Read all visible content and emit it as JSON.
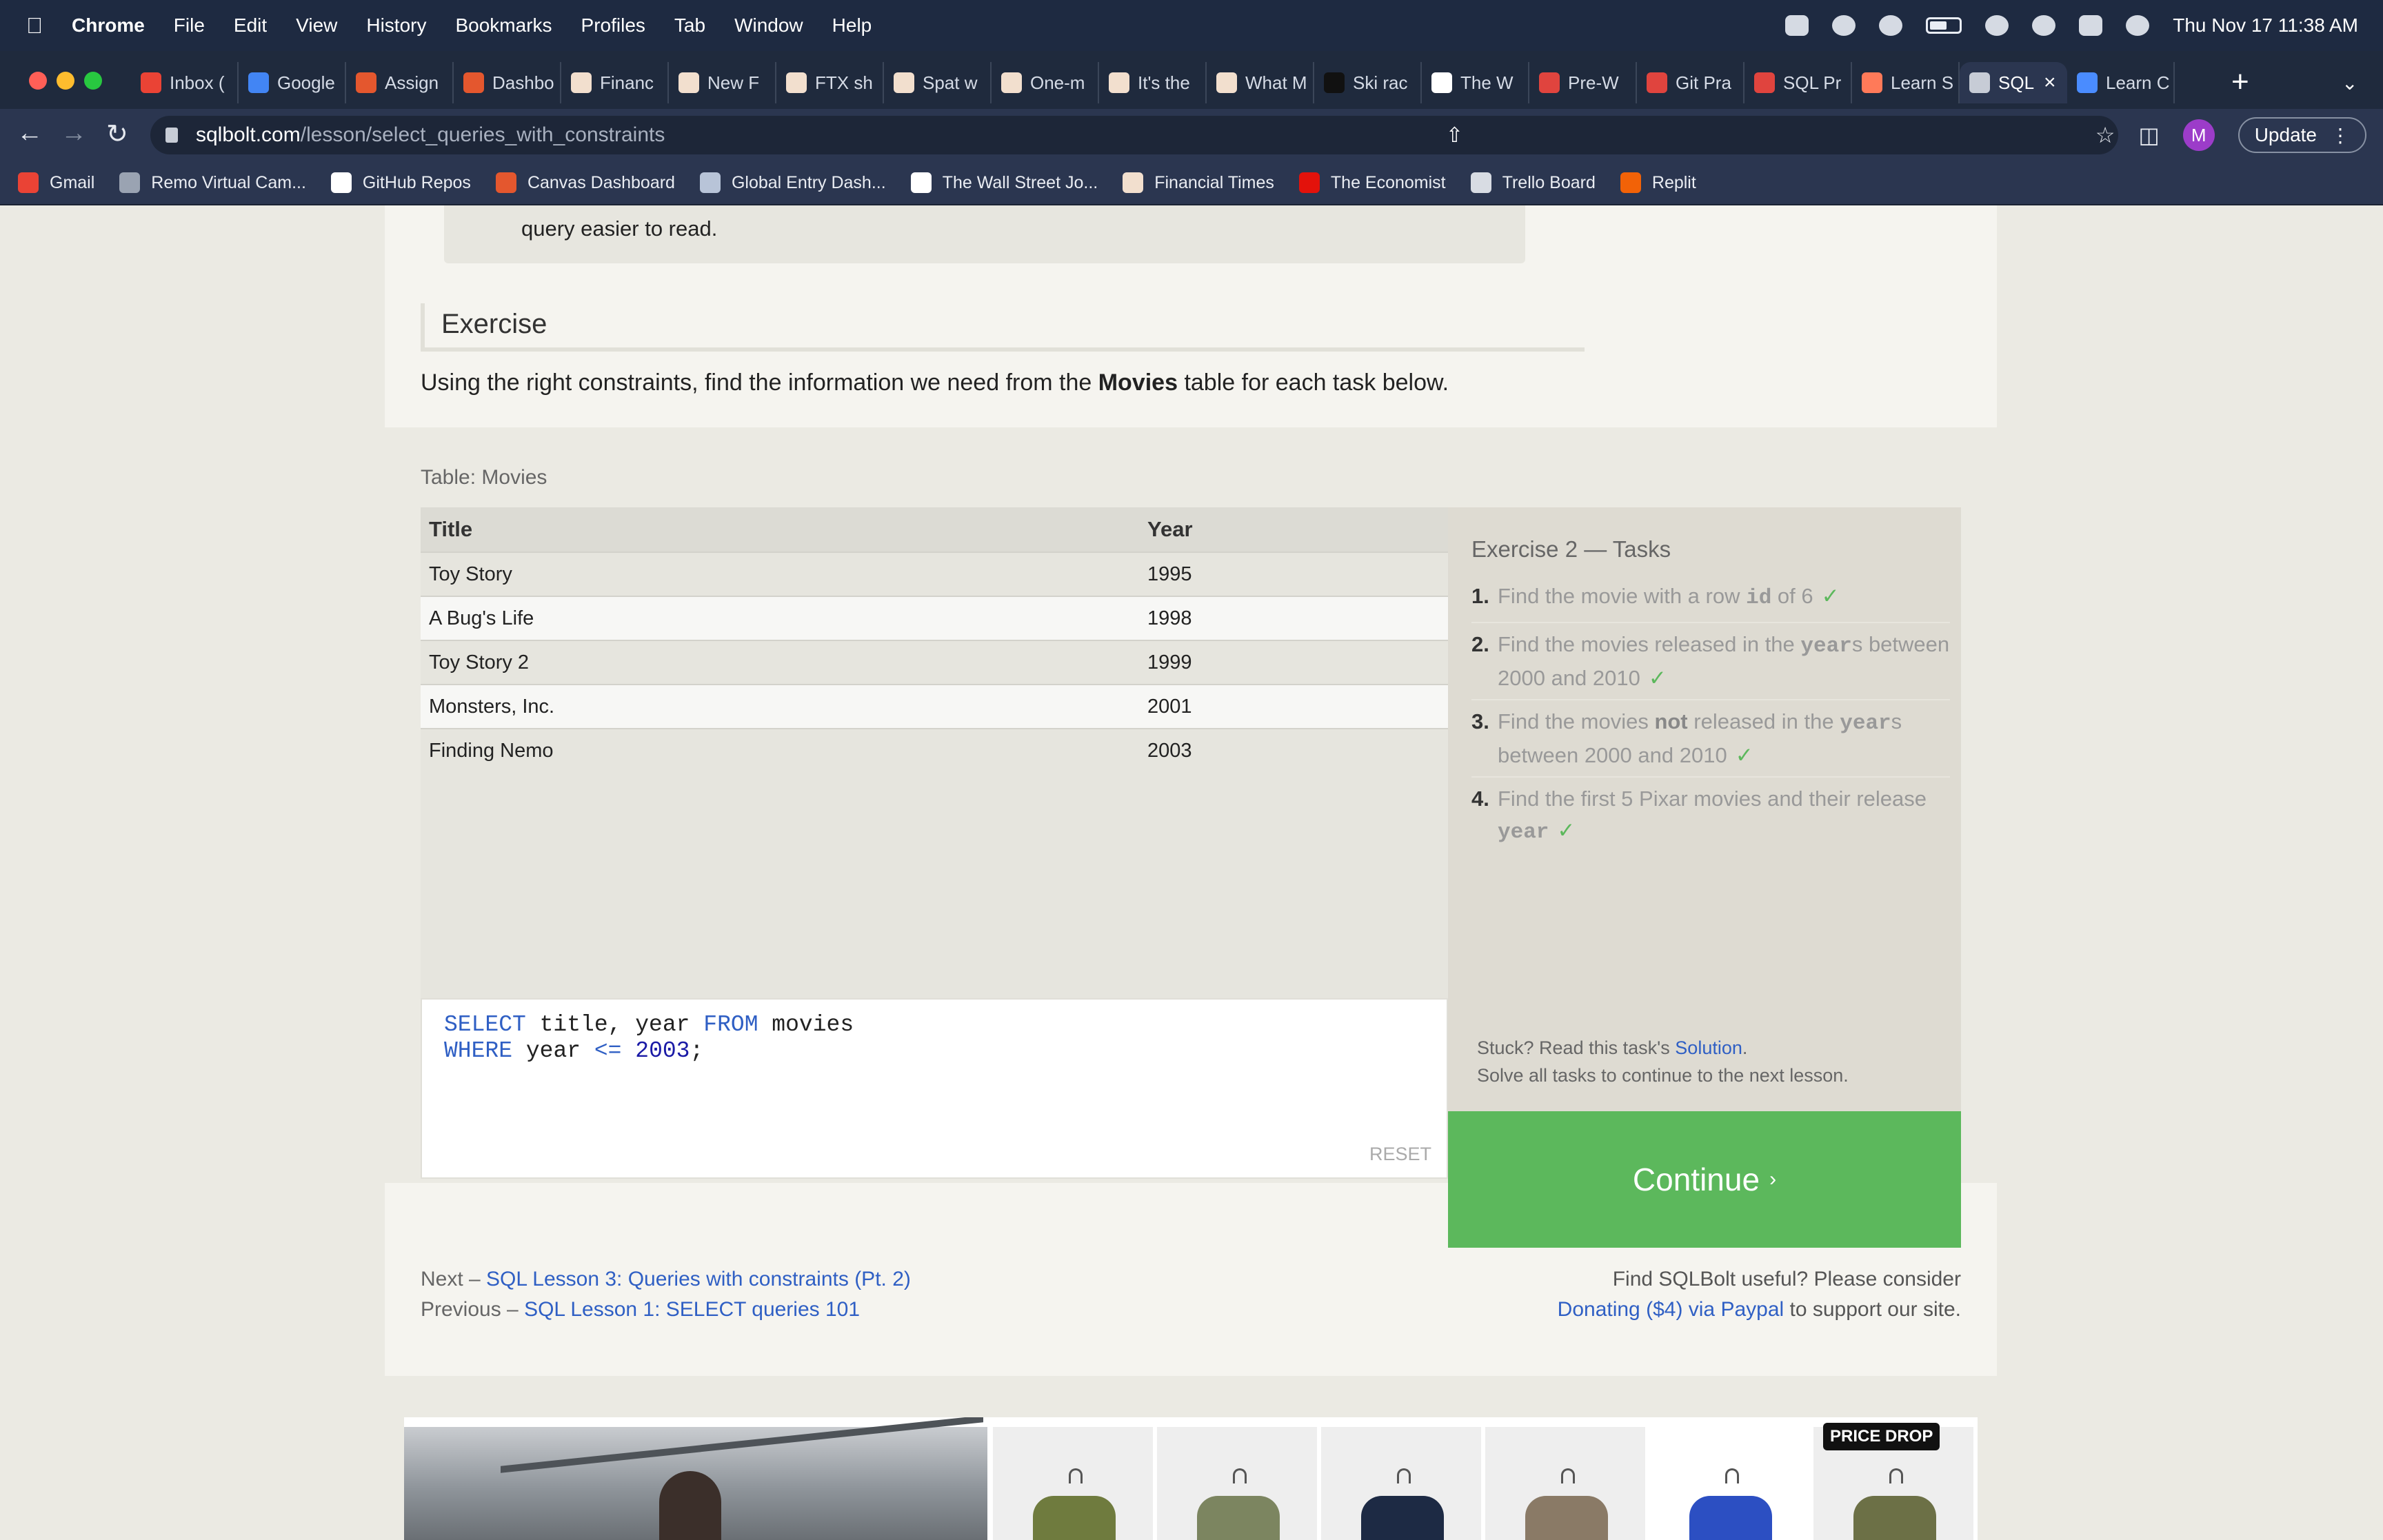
{
  "menubar": {
    "app": "Chrome",
    "items": [
      "File",
      "Edit",
      "View",
      "History",
      "Bookmarks",
      "Profiles",
      "Tab",
      "Window",
      "Help"
    ],
    "clock": "Thu Nov 17  11:38 AM"
  },
  "tabs": [
    {
      "label": "Inbox (",
      "icon": "gmail-icon",
      "color": "#ea4335"
    },
    {
      "label": "Google",
      "icon": "calendar-icon",
      "color": "#4285f4"
    },
    {
      "label": "Assign",
      "icon": "canvas-icon",
      "color": "#e4572e"
    },
    {
      "label": "Dashbo",
      "icon": "canvas-icon",
      "color": "#e4572e"
    },
    {
      "label": "Financ",
      "icon": "ft-icon",
      "color": "#f2dfce"
    },
    {
      "label": "New F",
      "icon": "ft-icon",
      "color": "#f2dfce"
    },
    {
      "label": "FTX sh",
      "icon": "ft-icon",
      "color": "#f2dfce"
    },
    {
      "label": "Spat w",
      "icon": "ft-icon",
      "color": "#f2dfce"
    },
    {
      "label": "One-m",
      "icon": "ft-icon",
      "color": "#f2dfce"
    },
    {
      "label": "It's the",
      "icon": "ft-icon",
      "color": "#f2dfce"
    },
    {
      "label": "What M",
      "icon": "ft-icon",
      "color": "#f2dfce"
    },
    {
      "label": "Ski rac",
      "icon": "news-icon",
      "color": "#111111"
    },
    {
      "label": "The W",
      "icon": "wsj-icon",
      "color": "#ffffff"
    },
    {
      "label": "Pre-W",
      "icon": "sqlbolt-icon",
      "color": "#e0443e"
    },
    {
      "label": "Git Pra",
      "icon": "sqlbolt-icon",
      "color": "#e0443e"
    },
    {
      "label": "SQL Pr",
      "icon": "sqlbolt-icon",
      "color": "#e0443e"
    },
    {
      "label": "Learn S",
      "icon": "hubspot-icon",
      "color": "#ff7a59"
    },
    {
      "label": "SQL",
      "icon": "database-icon",
      "color": "#c7ccd6",
      "active": true
    },
    {
      "label": "Learn C",
      "icon": "learn-icon",
      "color": "#4a8cff"
    }
  ],
  "address": {
    "domain": "sqlbolt.com",
    "path": "/lesson/select_queries_with_constraints",
    "update_label": "Update",
    "avatar_letter": "M"
  },
  "bookmarks": [
    {
      "label": "Gmail",
      "icon": "gmail-icon",
      "color": "#ea4335"
    },
    {
      "label": "Remo Virtual Cam...",
      "icon": "globe-icon",
      "color": "#9aa3b2"
    },
    {
      "label": "GitHub Repos",
      "icon": "github-icon",
      "color": "#ffffff"
    },
    {
      "label": "Canvas Dashboard",
      "icon": "canvas-icon",
      "color": "#e4572e"
    },
    {
      "label": "Global Entry Dash...",
      "icon": "seal-icon",
      "color": "#b8c4d8"
    },
    {
      "label": "The Wall Street Jo...",
      "icon": "wsj-icon",
      "color": "#ffffff"
    },
    {
      "label": "Financial Times",
      "icon": "ft-icon",
      "color": "#f2dfce"
    },
    {
      "label": "The Economist",
      "icon": "economist-icon",
      "color": "#e3120b"
    },
    {
      "label": "Trello Board",
      "icon": "trello-icon",
      "color": "#d8dce3"
    },
    {
      "label": "Replit",
      "icon": "replit-icon",
      "color": "#f26207"
    }
  ],
  "lesson": {
    "note_tail": "query easier to read.",
    "exercise_heading": "Exercise",
    "exercise_desc_before": "Using the right constraints, find the information we need from the ",
    "exercise_desc_bold": "Movies",
    "exercise_desc_after": " table for each task below."
  },
  "table": {
    "label": "Table: Movies",
    "columns": [
      "Title",
      "Year"
    ],
    "rows": [
      [
        "Toy Story",
        "1995"
      ],
      [
        "A Bug's Life",
        "1998"
      ],
      [
        "Toy Story 2",
        "1999"
      ],
      [
        "Monsters, Inc.",
        "2001"
      ],
      [
        "Finding Nemo",
        "2003"
      ]
    ]
  },
  "editor": {
    "line1_kw1": "SELECT",
    "line1_mid": " title, year ",
    "line1_kw2": "FROM",
    "line1_end": " movies",
    "line2_kw": "WHERE",
    "line2_mid": " year ",
    "line2_op": "<=",
    "line2_num": " 2003",
    "line2_end": ";",
    "reset_label": "RESET"
  },
  "tasks": {
    "title": "Exercise 2 — Tasks",
    "items": [
      {
        "num": "1.",
        "pre": "Find the movie with a row ",
        "code": "id",
        "post": " of 6"
      },
      {
        "num": "2.",
        "pre": "Find the movies released in the ",
        "code": "year",
        "post": "s between 2000 and 2010"
      },
      {
        "num": "3.",
        "pre": "Find the movies ",
        "strong": "not",
        "mid": " released in the ",
        "code": "year",
        "post": "s between 2000 and 2010"
      },
      {
        "num": "4.",
        "pre": "Find the first 5 Pixar movies and their release ",
        "code": "year",
        "post": ""
      }
    ],
    "check": "✓",
    "stuck_pre": "Stuck? Read this task's ",
    "stuck_link": "Solution",
    "stuck_post": ".",
    "solve_all": "Solve all tasks to continue to the next lesson.",
    "continue_label": "Continue",
    "continue_arrow": "›"
  },
  "footer": {
    "next_prefix": "Next – ",
    "next_link": "SQL Lesson 3: Queries with constraints (Pt. 2)",
    "prev_prefix": "Previous – ",
    "prev_link": "SQL Lesson 1: SELECT queries 101",
    "support_line": "Find SQLBolt useful? Please consider",
    "donate_link": "Donating ($4) via Paypal",
    "donate_post": " to support our site."
  },
  "ad": {
    "badge": "PRICE DROP",
    "garment_colors": [
      "#6f7b3e",
      "#7c8560",
      "#1d2a44",
      "#8a7a66",
      "#2c4fc2",
      "#6c7046"
    ]
  }
}
